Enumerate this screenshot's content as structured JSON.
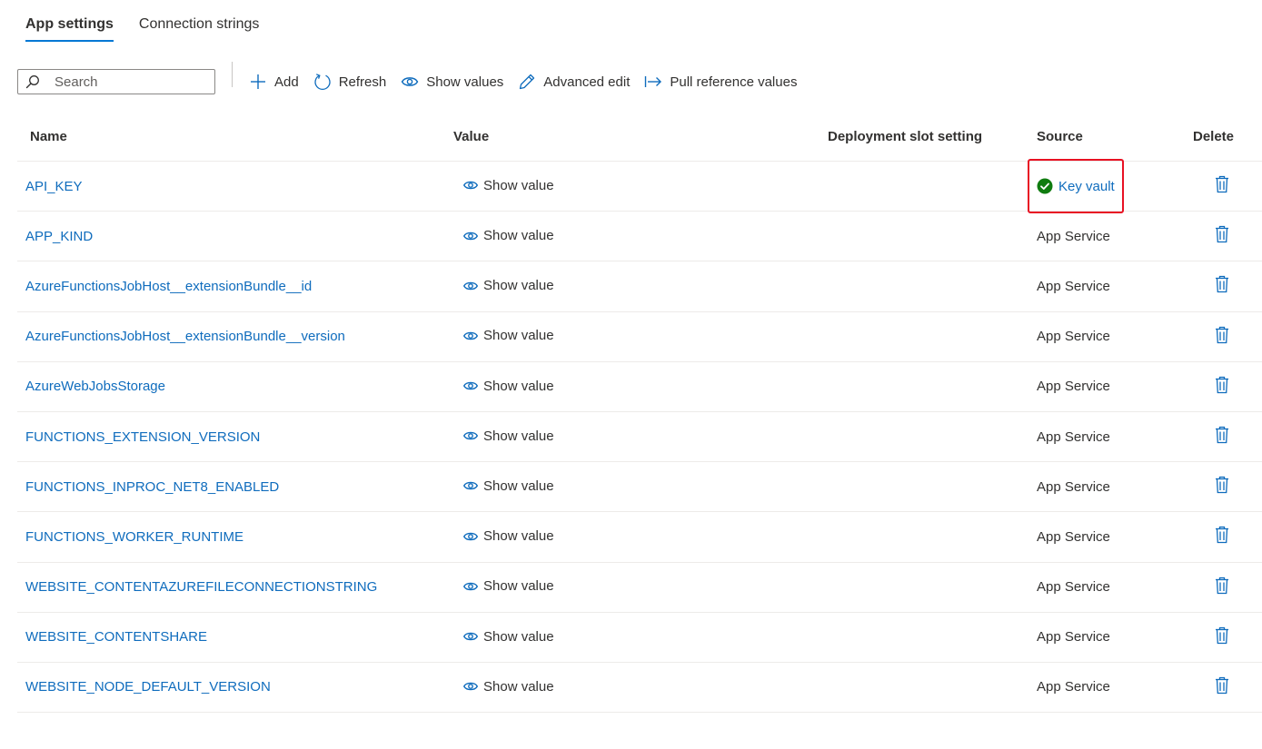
{
  "tabs": [
    {
      "label": "App settings",
      "active": true
    },
    {
      "label": "Connection strings",
      "active": false
    }
  ],
  "toolbar": {
    "search_placeholder": "Search",
    "add_label": "Add",
    "refresh_label": "Refresh",
    "show_values_label": "Show values",
    "advanced_edit_label": "Advanced edit",
    "pull_reference_label": "Pull reference values"
  },
  "table": {
    "headers": {
      "name": "Name",
      "value": "Value",
      "slot": "Deployment slot setting",
      "source": "Source",
      "delete": "Delete"
    },
    "rows": [
      {
        "name": "API_KEY",
        "value": "Show value",
        "source": "Key vault",
        "source_kind": "keyvault"
      },
      {
        "name": "APP_KIND",
        "value": "Show value",
        "source": "App Service"
      },
      {
        "name": "AzureFunctionsJobHost__extensionBundle__id",
        "value": "Show value",
        "source": "App Service"
      },
      {
        "name": "AzureFunctionsJobHost__extensionBundle__version",
        "value": "Show value",
        "source": "App Service"
      },
      {
        "name": "AzureWebJobsStorage",
        "value": "Show value",
        "source": "App Service"
      },
      {
        "name": "FUNCTIONS_EXTENSION_VERSION",
        "value": "Show value",
        "source": "App Service"
      },
      {
        "name": "FUNCTIONS_INPROC_NET8_ENABLED",
        "value": "Show value",
        "source": "App Service"
      },
      {
        "name": "FUNCTIONS_WORKER_RUNTIME",
        "value": "Show value",
        "source": "App Service"
      },
      {
        "name": "WEBSITE_CONTENTAZUREFILECONNECTIONSTRING",
        "value": "Show value",
        "source": "App Service"
      },
      {
        "name": "WEBSITE_CONTENTSHARE",
        "value": "Show value",
        "source": "App Service"
      },
      {
        "name": "WEBSITE_NODE_DEFAULT_VERSION",
        "value": "Show value",
        "source": "App Service"
      }
    ]
  },
  "colors": {
    "link": "#0f6cbd",
    "accent": "#0078d4",
    "success": "#107c10",
    "highlight": "#e81123"
  },
  "icons": {
    "search": "search-icon",
    "add": "plus-icon",
    "refresh": "refresh-icon",
    "show": "eye-icon",
    "edit": "pencil-icon",
    "pull": "arrow-right-bar-icon",
    "delete": "trash-icon",
    "check": "check-circle-icon"
  }
}
